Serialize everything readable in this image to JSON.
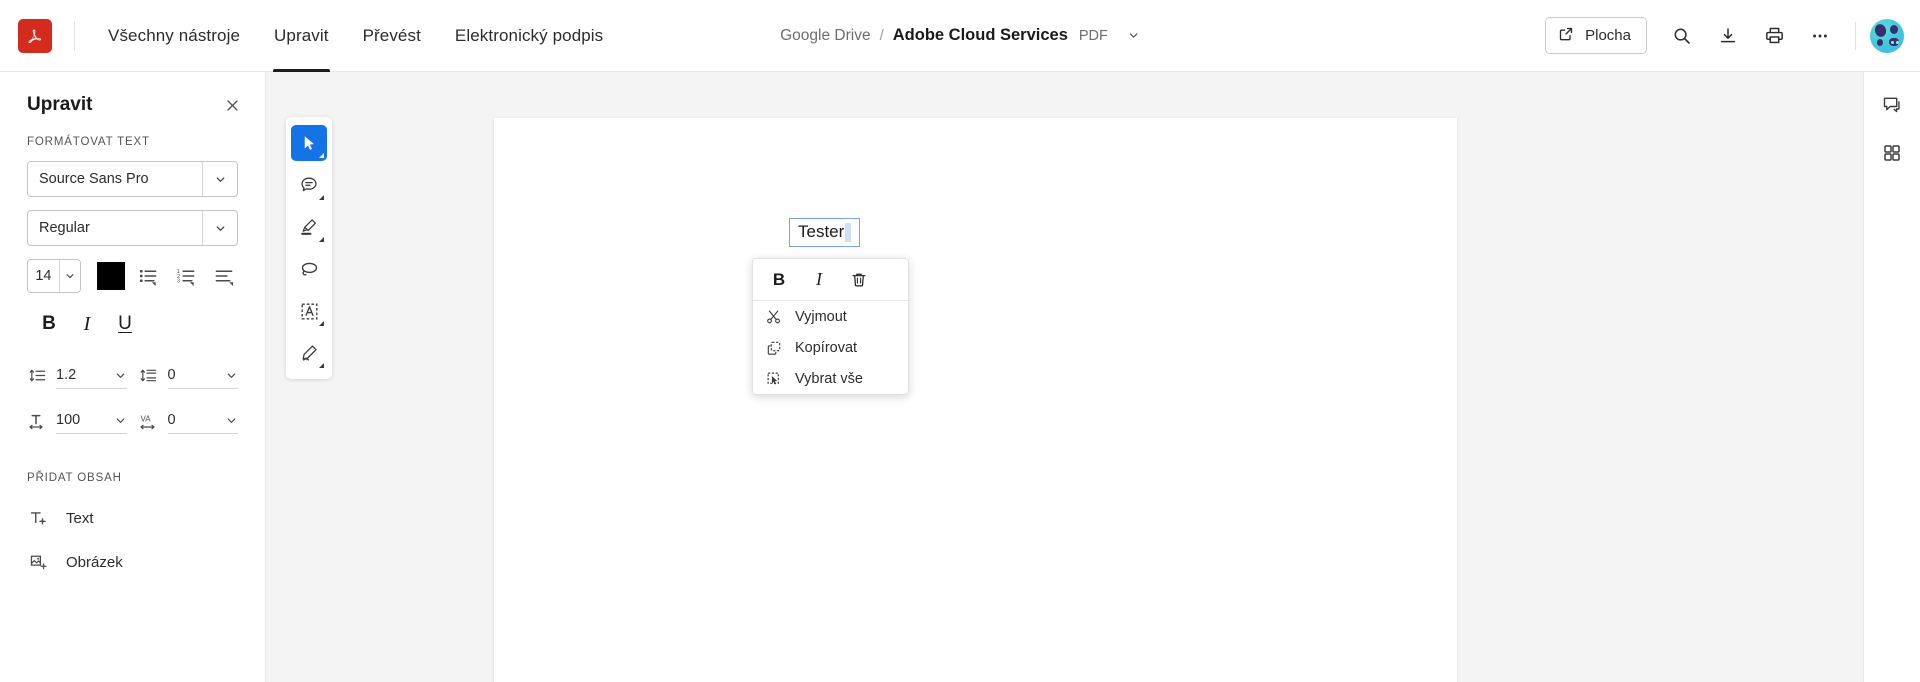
{
  "app": {
    "logo_icon": "adobe-acrobat-logo",
    "brand_color": "#d42b1e",
    "accent_color": "#1473e6"
  },
  "topbar": {
    "tabs": [
      {
        "label": "Všechny nástroje",
        "active": false
      },
      {
        "label": "Upravit",
        "active": true
      },
      {
        "label": "Převést",
        "active": false
      },
      {
        "label": "Elektronický podpis",
        "active": false
      }
    ],
    "breadcrumb": {
      "source": "Google Drive",
      "separator": "/",
      "title": "Adobe Cloud Services",
      "extension": "PDF",
      "caret_icon": "chevron-down-icon"
    },
    "actions": {
      "share_label": "Plocha",
      "share_icon": "external-link-icon",
      "search_icon": "search-icon",
      "download_icon": "download-icon",
      "print_icon": "print-icon",
      "more_icon": "ellipsis-icon",
      "avatar_icon": "user-avatar"
    }
  },
  "left_panel": {
    "title": "Upravit",
    "close_icon": "close-icon",
    "section_format_label": "FORMÁTOVAT TEXT",
    "font_family": {
      "value": "Source Sans Pro",
      "caret_icon": "chevron-down-icon"
    },
    "font_style": {
      "value": "Regular",
      "caret_icon": "chevron-down-icon"
    },
    "font_size": {
      "value": "14",
      "caret_icon": "chevron-down-icon"
    },
    "text_color": "#000000",
    "list_buttons": [
      {
        "name": "bulleted-list-icon"
      },
      {
        "name": "numbered-list-icon"
      },
      {
        "name": "text-align-icon"
      }
    ],
    "style_buttons": [
      {
        "label": "B",
        "name": "bold-button"
      },
      {
        "label": "I",
        "name": "italic-button"
      },
      {
        "label": "U",
        "name": "underline-button"
      }
    ],
    "spacing": [
      {
        "icon": "line-spacing-icon",
        "value": "1.2",
        "caret_icon": "chevron-down-icon"
      },
      {
        "icon": "paragraph-spacing-icon",
        "value": "0",
        "caret_icon": "chevron-down-icon"
      },
      {
        "icon": "horizontal-scale-icon",
        "value": "100",
        "caret_icon": "chevron-down-icon"
      },
      {
        "icon": "letter-spacing-icon",
        "value": "0",
        "caret_icon": "chevron-down-icon"
      }
    ],
    "section_add_label": "PŘIDAT OBSAH",
    "add_items": [
      {
        "label": "Text",
        "icon": "add-text-icon"
      },
      {
        "label": "Obrázek",
        "icon": "add-image-icon"
      }
    ]
  },
  "toolstrip": {
    "tools": [
      {
        "name": "select-tool",
        "icon": "cursor-arrow-icon",
        "active": true
      },
      {
        "name": "comment-tool",
        "icon": "comment-bubble-icon",
        "active": false
      },
      {
        "name": "highlight-tool",
        "icon": "highlighter-pen-icon",
        "active": false
      },
      {
        "name": "lasso-tool",
        "icon": "lasso-icon",
        "active": false
      },
      {
        "name": "text-select-tool",
        "icon": "select-text-box-icon",
        "active": false
      },
      {
        "name": "sign-tool",
        "icon": "fountain-pen-icon",
        "active": false
      }
    ]
  },
  "document": {
    "text_field_value": "Tester"
  },
  "context_menu": {
    "top_buttons": [
      {
        "label": "B",
        "name": "bold-button"
      },
      {
        "label": "I",
        "name": "italic-button"
      },
      {
        "label": "",
        "name": "delete-button",
        "icon": "trash-icon"
      }
    ],
    "items": [
      {
        "label": "Vyjmout",
        "icon": "scissors-icon"
      },
      {
        "label": "Kopírovat",
        "icon": "copy-icon"
      },
      {
        "label": "Vybrat vše",
        "icon": "select-all-icon"
      }
    ]
  },
  "right_rail": {
    "buttons": [
      {
        "name": "comment-panel-button",
        "icon": "comment-bubble-icon"
      },
      {
        "name": "all-tools-button",
        "icon": "grid-apps-icon"
      }
    ]
  }
}
